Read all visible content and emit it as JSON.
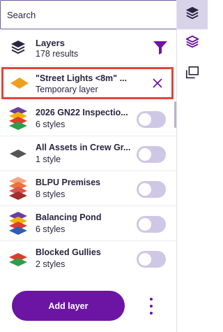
{
  "search": {
    "placeholder": "Search"
  },
  "rail": {
    "buttons": [
      {
        "icon": "layers-stack-icon",
        "active": true
      },
      {
        "icon": "layers-outline-icon",
        "active": false
      },
      {
        "icon": "copy-windows-icon",
        "active": false
      }
    ]
  },
  "layers_header": {
    "title": "Layers",
    "count": "178 results",
    "filter_icon": "funnel-icon"
  },
  "temporary_layer": {
    "name": "\"Street Lights <8m\" ...",
    "subtitle": "Temporary layer",
    "close_icon": "close-icon"
  },
  "layers": [
    {
      "name": "2026 GN22 Inspectio...",
      "styles": "6 styles",
      "enabled": false
    },
    {
      "name": "All Assets in Crew Gr...",
      "styles": "1 style",
      "enabled": false
    },
    {
      "name": "BLPU Premises",
      "styles": "8 styles",
      "enabled": false
    },
    {
      "name": "Balancing Pond",
      "styles": "6 styles",
      "enabled": false
    },
    {
      "name": "Blocked Gullies",
      "styles": "2 styles",
      "enabled": false
    }
  ],
  "footer": {
    "add_button": "Add layer",
    "more_icon": "more-vertical-icon"
  },
  "colors": {
    "accent": "#6c14a3",
    "highlight_border": "#e0463b",
    "toggle_off": "#cfc7e6",
    "rail_active": "#d9d3ea"
  }
}
